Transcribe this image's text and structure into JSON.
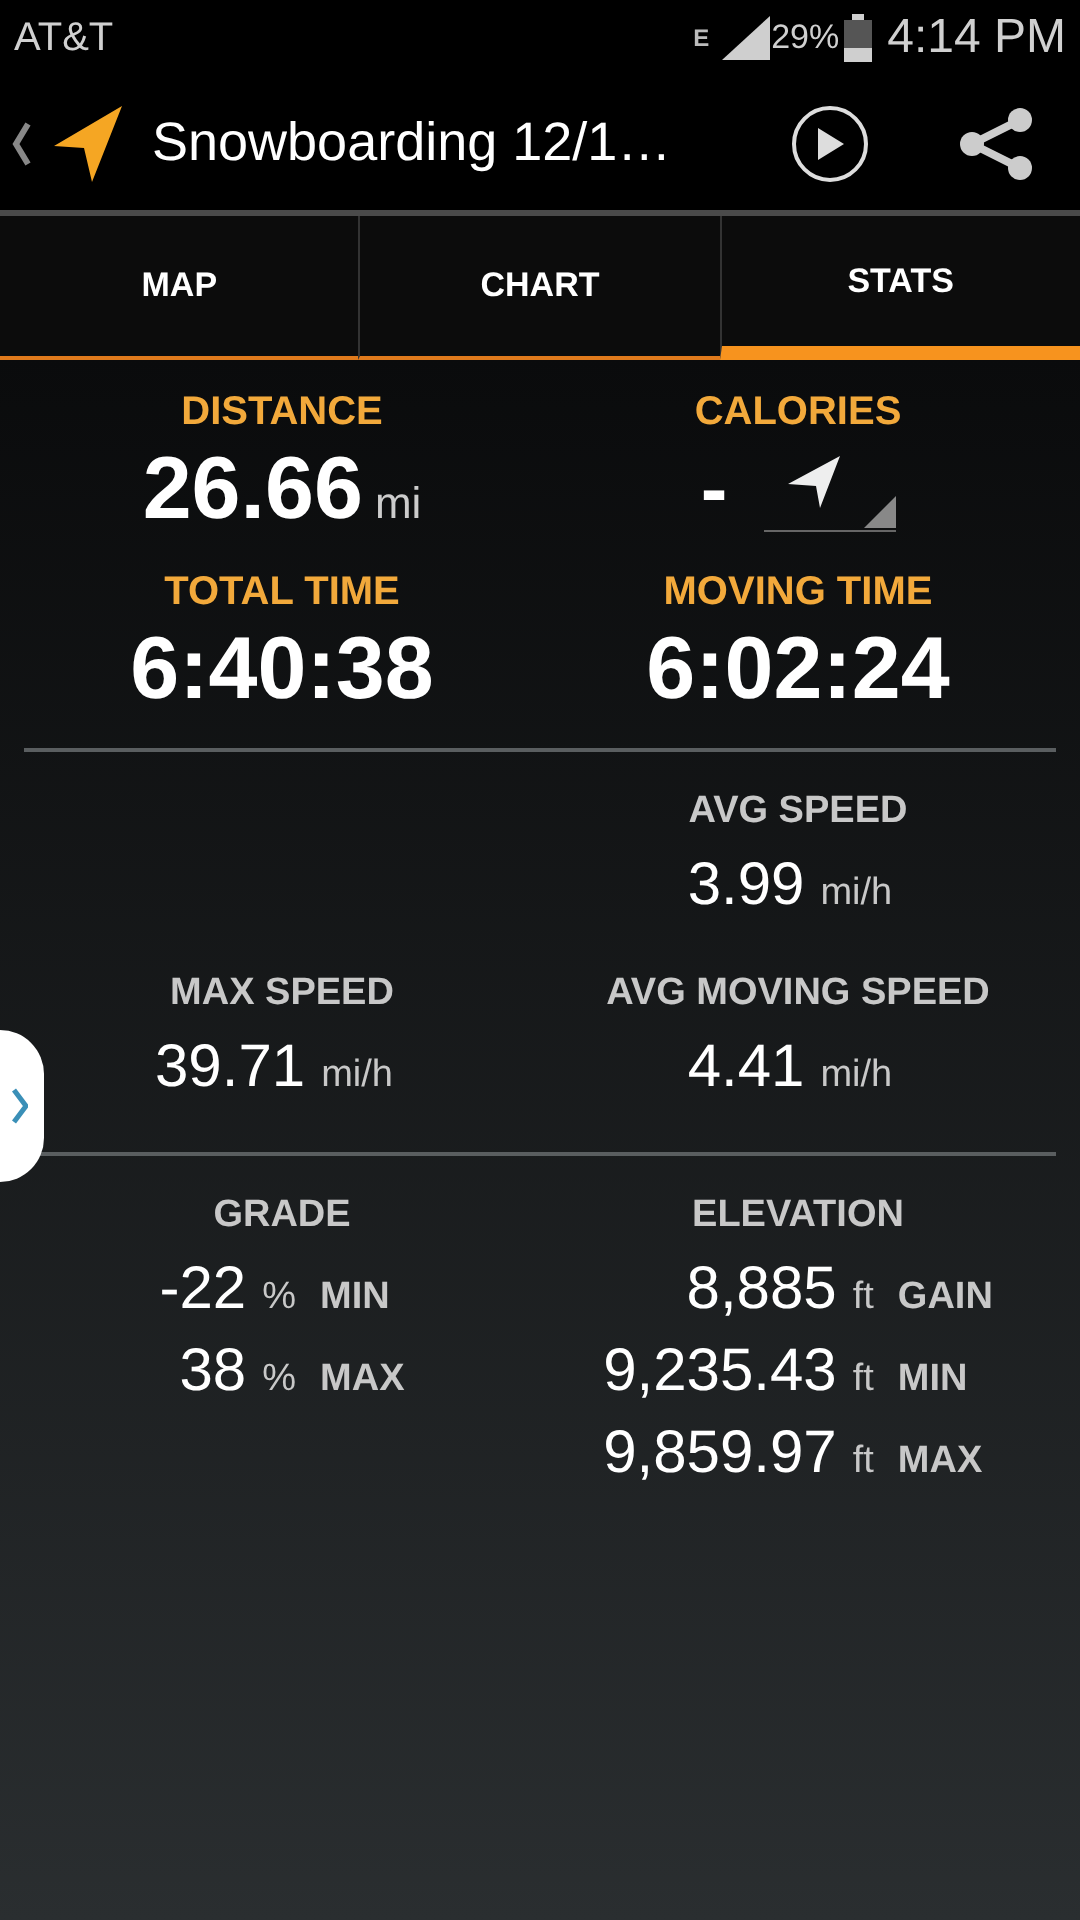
{
  "status_bar": {
    "carrier": "AT&T",
    "network": "E",
    "battery": "29%",
    "time": "4:14 PM"
  },
  "app_bar": {
    "title": "Snowboarding 12/1…"
  },
  "tabs": [
    {
      "label": "MAP",
      "selected": false
    },
    {
      "label": "CHART",
      "selected": false
    },
    {
      "label": "STATS",
      "selected": true
    }
  ],
  "sections": [
    {
      "rows": [
        {
          "left": {
            "kind": "big",
            "label": "DISTANCE",
            "value": "26.66",
            "unit": "mi"
          },
          "right": {
            "kind": "calories",
            "label": "CALORIES",
            "value": "-"
          }
        },
        {
          "left": {
            "kind": "big",
            "label": "TOTAL TIME",
            "value": "6:40:38"
          },
          "right": {
            "kind": "big",
            "label": "MOVING TIME",
            "value": "6:02:24"
          }
        }
      ]
    },
    {
      "rows": [
        {
          "right": {
            "kind": "small",
            "label": "AVG SPEED",
            "lines": [
              {
                "value": "3.99",
                "unit": "mi/h"
              }
            ]
          }
        },
        {
          "left": {
            "kind": "small",
            "label": "MAX SPEED",
            "lines": [
              {
                "value": "39.71",
                "unit": "mi/h"
              }
            ]
          },
          "right": {
            "kind": "small",
            "label": "AVG MOVING SPEED",
            "lines": [
              {
                "value": "4.41",
                "unit": "mi/h"
              }
            ]
          }
        }
      ]
    },
    {
      "rows": [
        {
          "left": {
            "kind": "small",
            "label": "GRADE",
            "lines": [
              {
                "value": "-22",
                "unit": "%",
                "tag": "MIN"
              },
              {
                "value": "38",
                "unit": "%",
                "tag": "MAX"
              }
            ]
          },
          "right": {
            "kind": "small",
            "label": "ELEVATION",
            "lines": [
              {
                "value": "8,885",
                "unit": "ft",
                "tag": "GAIN"
              },
              {
                "value": "9,235.43",
                "unit": "ft",
                "tag": "MIN"
              },
              {
                "value": "9,859.97",
                "unit": "ft",
                "tag": "MAX"
              }
            ]
          }
        }
      ]
    }
  ]
}
